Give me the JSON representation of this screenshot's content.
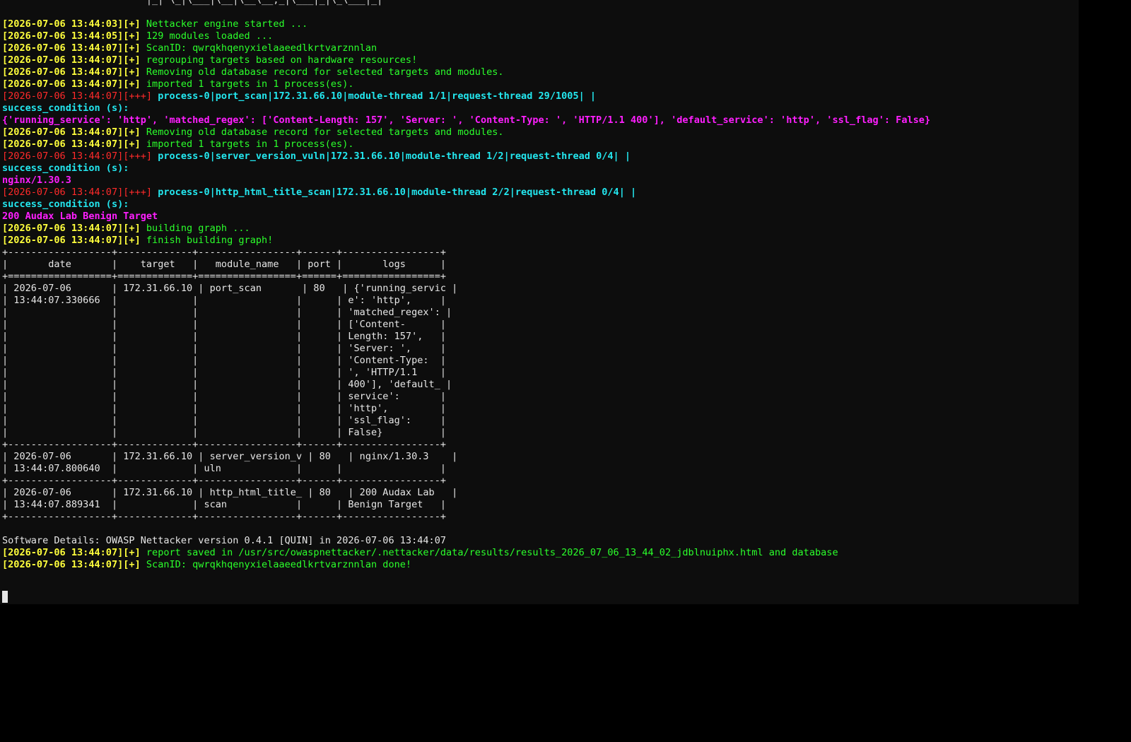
{
  "colors": {
    "terminal_bg": "#0d0d0d",
    "page_bg": "#000000",
    "yellow": "#ffff3c",
    "red": "#ff2a2a",
    "green": "#2bff2b",
    "cyan": "#23e7ef",
    "magenta": "#ff1fff",
    "white": "#e6e6e6"
  },
  "terminal": {
    "lines": [
      [
        {
          "t": "                         |_| \\_|\\___|\\__|\\__\\__,_|\\___|_|\\_\\___|_|",
          "c": "white"
        }
      ],
      [
        {
          "t": "",
          "c": "white"
        }
      ],
      [
        {
          "t": "[2026-07-06 13:44:03][+] ",
          "c": "yellow",
          "b": true
        },
        {
          "t": "Nettacker engine started ...",
          "c": "green"
        }
      ],
      [
        {
          "t": "[2026-07-06 13:44:05][+] ",
          "c": "yellow",
          "b": true
        },
        {
          "t": "129 modules loaded ...",
          "c": "green"
        }
      ],
      [
        {
          "t": "[2026-07-06 13:44:07][+] ",
          "c": "yellow",
          "b": true
        },
        {
          "t": "ScanID: qwrqkhqenyxielaaeedlkrtvarznnlan",
          "c": "green"
        }
      ],
      [
        {
          "t": "[2026-07-06 13:44:07][+] ",
          "c": "yellow",
          "b": true
        },
        {
          "t": "regrouping targets based on hardware resources!",
          "c": "green"
        }
      ],
      [
        {
          "t": "[2026-07-06 13:44:07][+] ",
          "c": "yellow",
          "b": true
        },
        {
          "t": "Removing old database record for selected targets and modules.",
          "c": "green"
        }
      ],
      [
        {
          "t": "[2026-07-06 13:44:07][+] ",
          "c": "yellow",
          "b": true
        },
        {
          "t": "imported 1 targets in 1 process(es).",
          "c": "green"
        }
      ],
      [
        {
          "t": "[2026-07-06 13:44:07][+++] ",
          "c": "red"
        },
        {
          "t": "process-0|port_scan|172.31.66.10|module-thread 1/1|request-thread 29/1005| |",
          "c": "cyan",
          "b": true
        }
      ],
      [
        {
          "t": "success_condition (s):",
          "c": "cyan",
          "b": true
        }
      ],
      [
        {
          "t": "{'running_service': 'http', 'matched_regex': ['Content-Length: 157', 'Server: ', 'Content-Type: ', 'HTTP/1.1 400'], 'default_service': 'http', 'ssl_flag': False}",
          "c": "magenta",
          "b": true
        }
      ],
      [
        {
          "t": "[2026-07-06 13:44:07][+] ",
          "c": "yellow",
          "b": true
        },
        {
          "t": "Removing old database record for selected targets and modules.",
          "c": "green"
        }
      ],
      [
        {
          "t": "[2026-07-06 13:44:07][+] ",
          "c": "yellow",
          "b": true
        },
        {
          "t": "imported 1 targets in 1 process(es).",
          "c": "green"
        }
      ],
      [
        {
          "t": "[2026-07-06 13:44:07][+++] ",
          "c": "red"
        },
        {
          "t": "process-0|server_version_vuln|172.31.66.10|module-thread 1/2|request-thread 0/4| |",
          "c": "cyan",
          "b": true
        }
      ],
      [
        {
          "t": "success_condition (s):",
          "c": "cyan",
          "b": true
        }
      ],
      [
        {
          "t": "nginx/1.30.3",
          "c": "magenta",
          "b": true
        }
      ],
      [
        {
          "t": "[2026-07-06 13:44:07][+++] ",
          "c": "red"
        },
        {
          "t": "process-0|http_html_title_scan|172.31.66.10|module-thread 2/2|request-thread 0/4| |",
          "c": "cyan",
          "b": true
        }
      ],
      [
        {
          "t": "success_condition (s):",
          "c": "cyan",
          "b": true
        }
      ],
      [
        {
          "t": "200 Audax Lab Benign Target",
          "c": "magenta",
          "b": true
        }
      ],
      [
        {
          "t": "[2026-07-06 13:44:07][+] ",
          "c": "yellow",
          "b": true
        },
        {
          "t": "building graph ...",
          "c": "green"
        }
      ],
      [
        {
          "t": "[2026-07-06 13:44:07][+] ",
          "c": "yellow",
          "b": true
        },
        {
          "t": "finish building graph!",
          "c": "green"
        }
      ],
      [
        {
          "t": "+------------------+-------------+-----------------+------+-----------------+",
          "c": "white"
        }
      ],
      [
        {
          "t": "|       date       |    target   |   module_name   | port |       logs      |",
          "c": "white"
        }
      ],
      [
        {
          "t": "+==================+=============+=================+======+=================+",
          "c": "white"
        }
      ],
      [
        {
          "t": "| 2026-07-06       | 172.31.66.10 | port_scan       | 80   | {'running_servic |",
          "c": "white"
        }
      ],
      [
        {
          "t": "| 13:44:07.330666  |             |                 |      | e': 'http',     |",
          "c": "white"
        }
      ],
      [
        {
          "t": "|                  |             |                 |      | 'matched_regex': |",
          "c": "white"
        }
      ],
      [
        {
          "t": "|                  |             |                 |      | ['Content-      |",
          "c": "white"
        }
      ],
      [
        {
          "t": "|                  |             |                 |      | Length: 157',   |",
          "c": "white"
        }
      ],
      [
        {
          "t": "|                  |             |                 |      | 'Server: ',     |",
          "c": "white"
        }
      ],
      [
        {
          "t": "|                  |             |                 |      | 'Content-Type:  |",
          "c": "white"
        }
      ],
      [
        {
          "t": "|                  |             |                 |      | ', 'HTTP/1.1    |",
          "c": "white"
        }
      ],
      [
        {
          "t": "|                  |             |                 |      | 400'], 'default_ |",
          "c": "white"
        }
      ],
      [
        {
          "t": "|                  |             |                 |      | service':       |",
          "c": "white"
        }
      ],
      [
        {
          "t": "|                  |             |                 |      | 'http',         |",
          "c": "white"
        }
      ],
      [
        {
          "t": "|                  |             |                 |      | 'ssl_flag':     |",
          "c": "white"
        }
      ],
      [
        {
          "t": "|                  |             |                 |      | False}          |",
          "c": "white"
        }
      ],
      [
        {
          "t": "+------------------+-------------+-----------------+------+-----------------+",
          "c": "white"
        }
      ],
      [
        {
          "t": "| 2026-07-06       | 172.31.66.10 | server_version_v | 80   | nginx/1.30.3    |",
          "c": "white"
        }
      ],
      [
        {
          "t": "| 13:44:07.800640  |             | uln             |      |                 |",
          "c": "white"
        }
      ],
      [
        {
          "t": "+------------------+-------------+-----------------+------+-----------------+",
          "c": "white"
        }
      ],
      [
        {
          "t": "| 2026-07-06       | 172.31.66.10 | http_html_title_ | 80   | 200 Audax Lab   |",
          "c": "white"
        }
      ],
      [
        {
          "t": "| 13:44:07.889341  |             | scan            |      | Benign Target   |",
          "c": "white"
        }
      ],
      [
        {
          "t": "+------------------+-------------+-----------------+------+-----------------+",
          "c": "white"
        }
      ],
      [
        {
          "t": "",
          "c": "white"
        }
      ],
      [
        {
          "t": "Software Details: OWASP Nettacker version 0.4.1 [QUIN] in 2026-07-06 13:44:07",
          "c": "white"
        }
      ],
      [
        {
          "t": "[2026-07-06 13:44:07][+] ",
          "c": "yellow",
          "b": true
        },
        {
          "t": "report saved in /usr/src/owaspnettacker/.nettacker/data/results/results_2026_07_06_13_44_02_jdblnuiphx.html and database",
          "c": "green"
        }
      ],
      [
        {
          "t": "[2026-07-06 13:44:07][+] ",
          "c": "yellow",
          "b": true
        },
        {
          "t": "ScanID: qwrqkhqenyxielaaeedlkrtvarznnlan done!",
          "c": "green"
        }
      ]
    ]
  }
}
